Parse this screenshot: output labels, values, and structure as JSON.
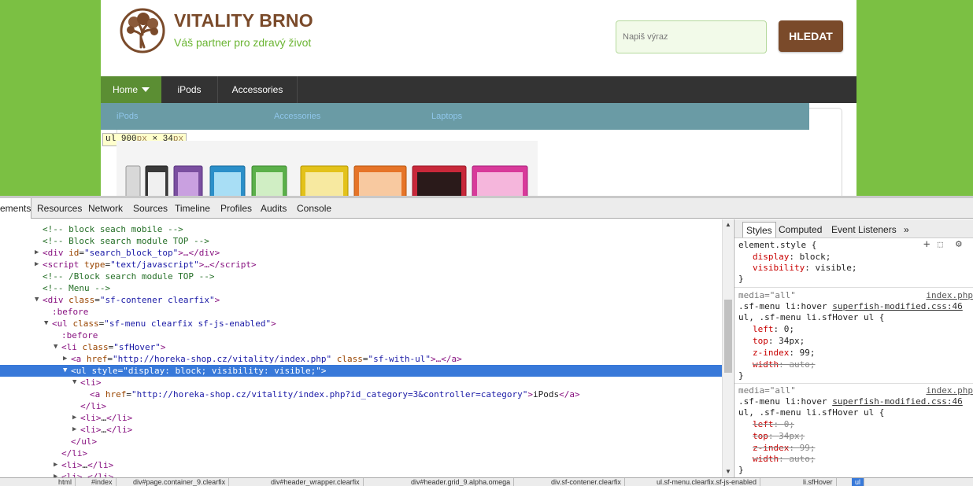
{
  "site": {
    "brand_title": "VITALITY BRNO",
    "brand_subtitle": "Váš partner pro zdravý život",
    "search_placeholder": "Napiš výraz",
    "search_button": "HLEDAT",
    "menu": [
      "Home",
      "iPods",
      "Accessories"
    ],
    "submenu": [
      "iPods",
      "Accessories",
      "Laptops"
    ],
    "tooltip": {
      "tag": "ul",
      "width": "900",
      "height": "34",
      "unit": "px",
      "sep": "×"
    },
    "colors": {
      "brand": "#7a4a2a",
      "green": "#7bc043",
      "menubar": "#333333",
      "submenu": "#6a9ba5"
    }
  },
  "devtools": {
    "tabs": [
      "ements",
      "Resources",
      "Network",
      "Sources",
      "Timeline",
      "Profiles",
      "Audits",
      "Console"
    ],
    "side_tabs": [
      "Styles",
      "Computed",
      "Event Listeners",
      "»"
    ],
    "dom": {
      "l0": "<!-- block seach mobile -->",
      "l1": "<!-- Block search module TOP -->",
      "l2a": "div",
      "l2b": "id",
      "l2c": "\"search_block_top\"",
      "l2d": ">…</",
      "l2e": "div",
      "l3a": "script",
      "l3b": "type",
      "l3c": "\"text/javascript\"",
      "l3d": ">…</",
      "l3e": "script",
      "l4": "<!-- /Block search module TOP -->",
      "l5": "<!-- Menu -->",
      "l6a": "div",
      "l6b": "class",
      "l6c": "\"sf-contener clearfix\"",
      "l7": ":before",
      "l8a": "ul",
      "l8b": "class",
      "l8c": "\"sf-menu clearfix sf-js-enabled\"",
      "l9": ":before",
      "l10a": "li",
      "l10b": "class",
      "l10c": "\"sfHover\"",
      "l11a": "a",
      "l11b": "href",
      "l11c": "\"http://horeka-shop.cz/vitality/index.php\"",
      "l11d": "class",
      "l11e": "\"sf-with-ul\"",
      "l11f": ">…</",
      "l11g": "a",
      "l12a": "ul",
      "l12b": "style",
      "l12c": "\"display: block; visibility: visible;\"",
      "l13": "li",
      "l14a": "a",
      "l14b": "href",
      "l14c": "\"http://horeka-shop.cz/vitality/index.php?id_category=3&controller=category\"",
      "l14d": "iPods",
      "l15": "li",
      "l16": "li",
      "l17": "li",
      "l18": "ul",
      "l19": "li",
      "l20": "li",
      "l21": "li",
      "ellipsis": "…"
    },
    "styles": {
      "element_style": "element.style {",
      "p1_name": "display",
      "p1_val": "block;",
      "p2_name": "visibility",
      "p2_val": "visible;",
      "close": "}",
      "media": "media=\"all\"",
      "source": "index.php",
      "rule_a1": ".sf-menu li:hover",
      "rule_file": "superfish-modified.css:46",
      "rule_a2": "ul, .sf-menu li.sfHover ul {",
      "r1p1": "left",
      "r1v1": "0;",
      "r1p2": "top",
      "r1v2": "34px;",
      "r1p3": "z-index",
      "r1v3": "99;",
      "r1p4": "width",
      "r1v4": "auto;",
      "r2p1": "left",
      "r2v1": "0;",
      "r2p2": "top",
      "r2v2": "34px;",
      "r2p3": "z-index",
      "r2v3": "99;",
      "r2p4": "width",
      "r2v4": "auto;"
    },
    "breadcrumbs": [
      "html",
      "#index",
      "div#page.container_9.clearfix",
      "div#header_wrapper.clearfix",
      "div#header.grid_9.alpha.omega",
      "div.sf-contener.clearfix",
      "ul.sf-menu.clearfix.sf-js-enabled",
      "li.sfHover",
      "ul"
    ]
  }
}
